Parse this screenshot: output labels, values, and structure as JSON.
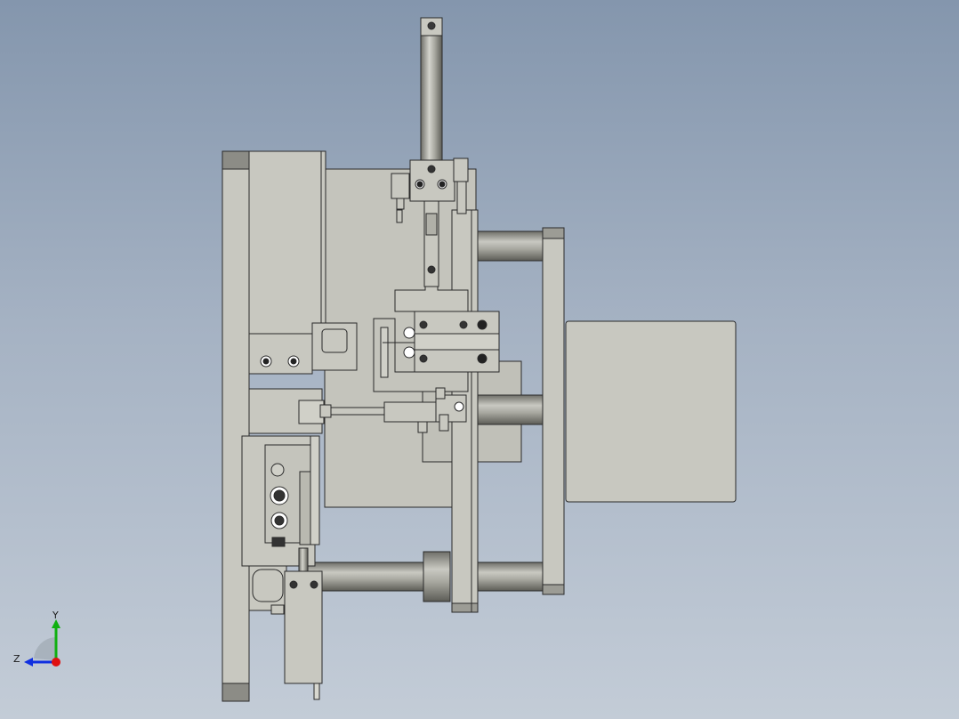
{
  "viewport": {
    "background_top": "#8496ad",
    "background_bottom": "#c3ccd7"
  },
  "model": {
    "part_color": "#c8c8c0",
    "edge_color": "#2a2a2a",
    "shade_color": "#a9a9a0",
    "rod_color": "#a0a098"
  },
  "triad": {
    "y_label": "Y",
    "z_label": "Z",
    "x_color": "#e01010",
    "y_color": "#10b010",
    "z_color": "#1030e0"
  }
}
